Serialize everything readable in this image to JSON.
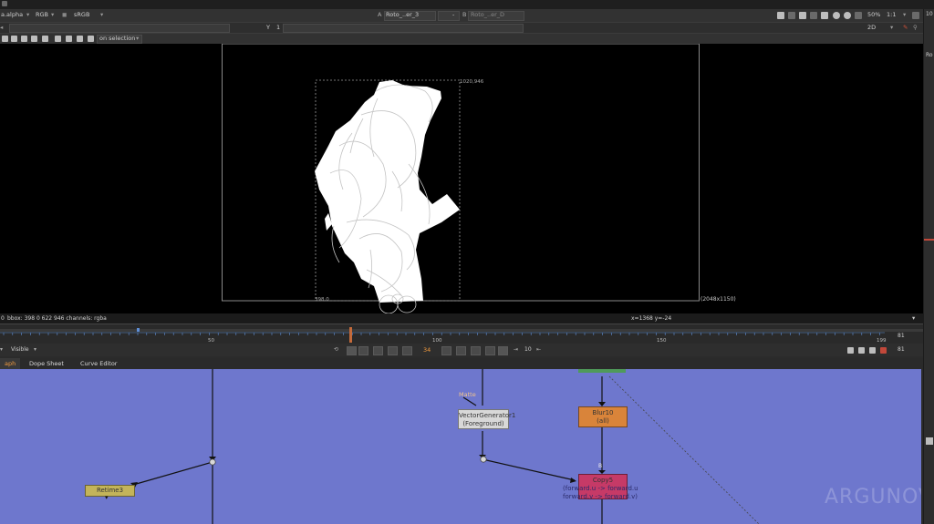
{
  "viewer_toolbar": {
    "channel": "a.alpha",
    "colorspace_a": "RGB",
    "colorspace_b": "sRGB",
    "input_a_label": "A",
    "input_a_value": "Roto_..er_3",
    "input_sep": "-",
    "input_b_label": "B",
    "input_b_value": "Roto_..er_D",
    "zoom": "50%",
    "ratio": "1:1",
    "mode": "2D",
    "y_label": "Y",
    "y_value": "1",
    "on_selection": "on selection"
  },
  "viewer": {
    "format_label": "(2048x1150)",
    "bbox_top_right": "1020,946",
    "bbox_bottom_left": "398,0"
  },
  "status": {
    "info_prefix": "0",
    "info": "bbox: 398 0 622 946 channels: rgba",
    "coords": "x=1368 y=-24"
  },
  "timeline": {
    "ticks": [
      "50",
      "100",
      "150",
      "199"
    ],
    "end_frame": "81",
    "visible_label": "Visible",
    "current_frame": "34",
    "increment": "10",
    "frame_display": "81"
  },
  "tabs": [
    {
      "label": "aph"
    },
    {
      "label": "Dope Sheet"
    },
    {
      "label": "Curve Editor"
    }
  ],
  "nodes": {
    "vector_generator_name": "VectorGenerator1",
    "vector_generator_sub": "(Foreground)",
    "matte_label": "Matte",
    "blur_name": "Blur10",
    "blur_sub": "(all)",
    "copy_name": "Copy5",
    "copy_sub_1": "(forward.u -> forward.u",
    "copy_sub_2": "forward.v -> forward.v)",
    "retime_name": "Retime3",
    "copy_input_label": "B"
  },
  "watermark": "ARGUNOV",
  "right_panel": {
    "top_number": "10",
    "label": "Ro"
  },
  "colors": {
    "nodegraph_bg": "#6e77cd",
    "blur_node": "#d9843a",
    "copy_node": "#c63a67",
    "retime_node": "#c3b45a",
    "vector_node": "#d8d8d8",
    "accent": "#f19a3e"
  }
}
